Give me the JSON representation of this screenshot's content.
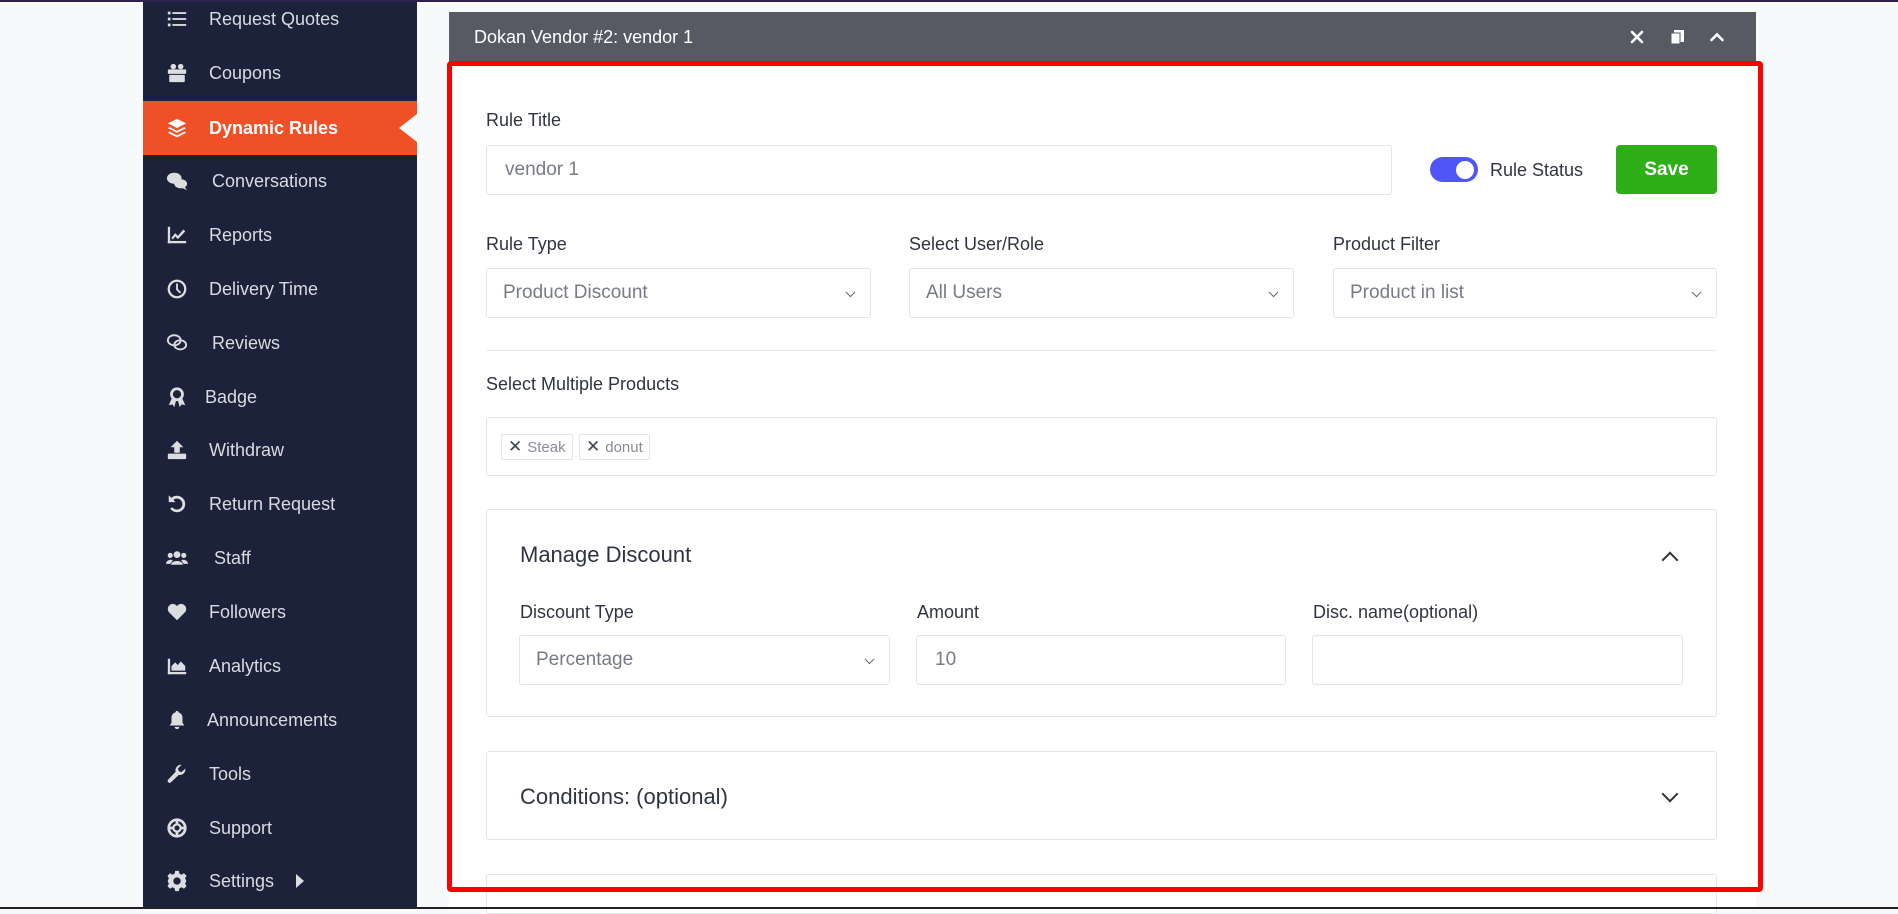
{
  "sidebar": {
    "items": [
      {
        "label": "Request Quotes",
        "icon": "list-icon"
      },
      {
        "label": "Coupons",
        "icon": "gift-icon"
      },
      {
        "label": "Dynamic Rules",
        "icon": "layers-icon",
        "active": true
      },
      {
        "label": "Conversations",
        "icon": "comments-icon"
      },
      {
        "label": "Reports",
        "icon": "chart-line-icon"
      },
      {
        "label": "Delivery Time",
        "icon": "clock-icon"
      },
      {
        "label": "Reviews",
        "icon": "comment-dots-icon"
      },
      {
        "label": "Badge",
        "icon": "award-icon"
      },
      {
        "label": "Withdraw",
        "icon": "upload-icon"
      },
      {
        "label": "Return Request",
        "icon": "undo-icon"
      },
      {
        "label": "Staff",
        "icon": "users-icon"
      },
      {
        "label": "Followers",
        "icon": "heart-icon"
      },
      {
        "label": "Analytics",
        "icon": "area-chart-icon"
      },
      {
        "label": "Announcements",
        "icon": "bell-icon"
      },
      {
        "label": "Tools",
        "icon": "wrench-icon"
      },
      {
        "label": "Support",
        "icon": "life-ring-icon"
      },
      {
        "label": "Settings",
        "icon": "gear-icon",
        "has_submenu": true
      }
    ]
  },
  "panel": {
    "title": "Dokan Vendor #2: vendor 1",
    "actions": [
      "close-icon",
      "duplicate-icon",
      "chevron-up-icon"
    ]
  },
  "form": {
    "rule_title_label": "Rule Title",
    "rule_title_value": "vendor 1",
    "rule_status_label": "Rule Status",
    "rule_status_on": true,
    "save_label": "Save",
    "rule_type_label": "Rule Type",
    "rule_type_value": "Product Discount",
    "user_role_label": "Select User/Role",
    "user_role_value": "All Users",
    "product_filter_label": "Product Filter",
    "product_filter_value": "Product in list",
    "multi_products_label": "Select Multiple Products",
    "selected_products": [
      "Steak",
      "donut"
    ]
  },
  "manage_discount": {
    "title": "Manage Discount",
    "discount_type_label": "Discount Type",
    "discount_type_value": "Percentage",
    "amount_label": "Amount",
    "amount_value": "10",
    "disc_name_label": "Disc. name(optional)",
    "disc_name_value": ""
  },
  "conditions": {
    "title": "Conditions: (optional)"
  },
  "colors": {
    "sidebar_bg": "#1c2239",
    "active_item": "#f05025",
    "header_bg": "#575a63",
    "toggle_on": "#4f55f6",
    "save_green": "#2eae17",
    "highlight_red": "#ff0000"
  }
}
